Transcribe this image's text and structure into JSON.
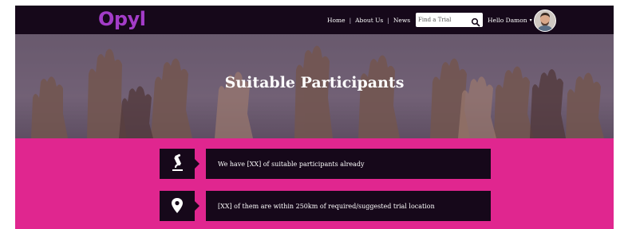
{
  "header": {
    "logo": "Opyl",
    "nav": [
      "Home",
      "About Us",
      "News"
    ],
    "nav_separator": "|",
    "search_placeholder": "Find a Trial",
    "user_greeting": "Hello Damon",
    "caret": "▾"
  },
  "hero": {
    "title": "Suitable Participants"
  },
  "stats": [
    {
      "icon": "microscope-icon",
      "text": "We have [XX] of suitable participants already"
    },
    {
      "icon": "location-pin-icon",
      "text": "[XX] of them are within 250km of required/suggested trial location"
    }
  ],
  "colors": {
    "header_bg": "#16081a",
    "logo": "#a33cc8",
    "band": "#e0268f",
    "card_bg": "#16081a"
  }
}
